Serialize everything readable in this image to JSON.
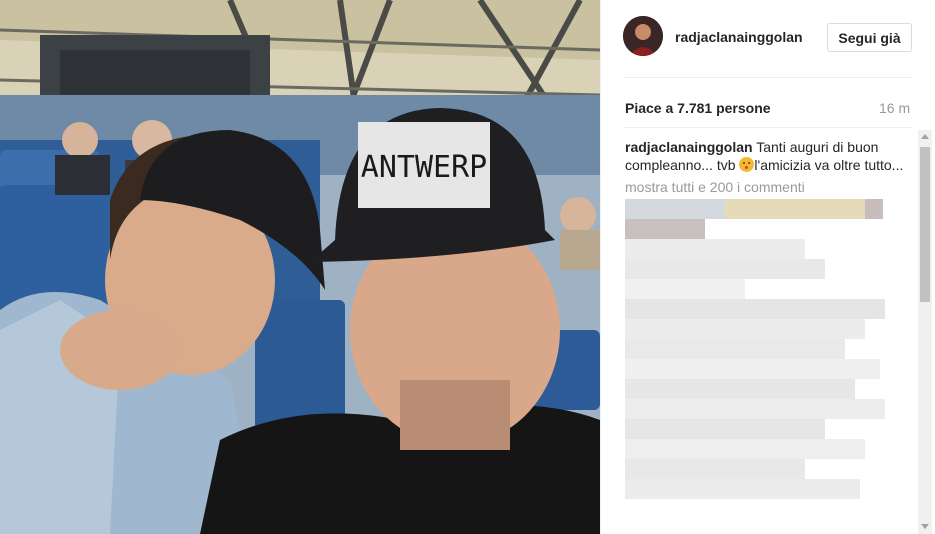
{
  "post": {
    "username": "radjaclanainggolan",
    "follow_label": "Segui già",
    "likes_text": "Piace a 7.781 persone",
    "time_ago": "16 m",
    "caption_user": "radjaclanainggolan",
    "caption_text_1": " Tanti auguri di buon compleanno... tvb ",
    "caption_text_2": "l'amicizia va oltre tutto...",
    "emoji_name": "kiss-face-emoji",
    "more_comments": "mostra tutti e 200 i commenti"
  },
  "photo": {
    "cap_text": "ANTWERP"
  },
  "colors": {
    "link_grey": "#999999",
    "text": "#262626",
    "border": "#dbdbdb"
  }
}
